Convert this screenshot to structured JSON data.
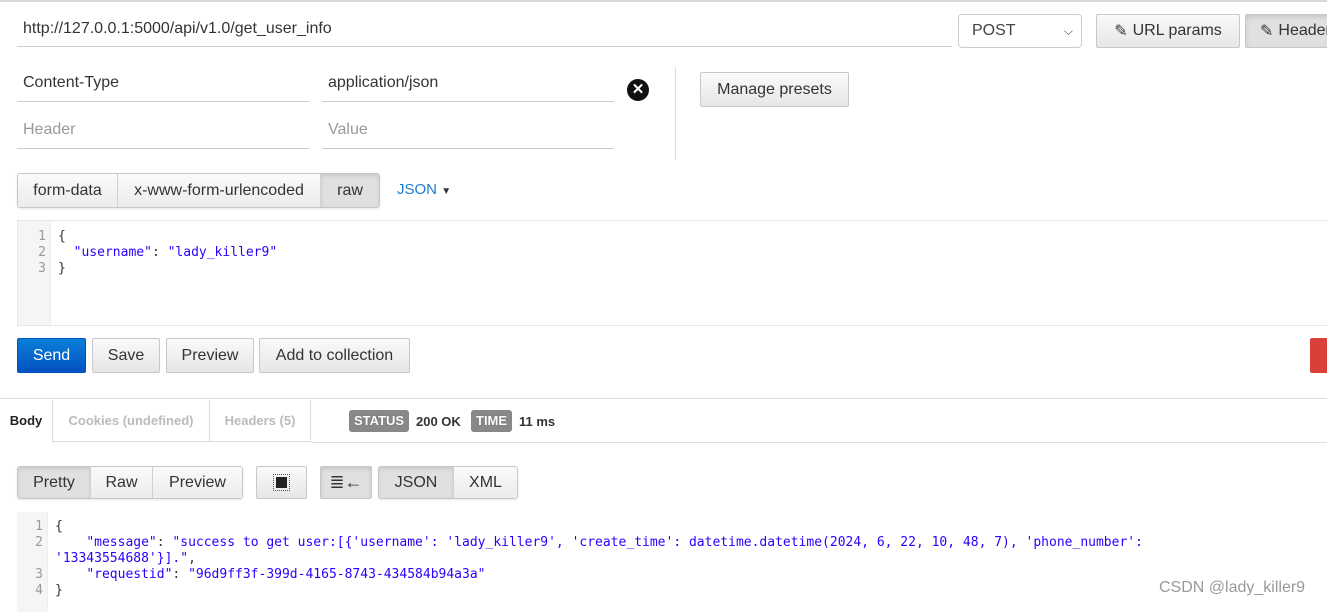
{
  "request": {
    "url": "http://127.0.0.1:5000/api/v1.0/get_user_info",
    "method": "POST",
    "url_params_label": "URL params",
    "headers_label": "Headers",
    "headers": [
      {
        "key": "Content-Type",
        "value": "application/json"
      }
    ],
    "header_placeholder": "Header",
    "value_placeholder": "Value",
    "manage_presets": "Manage presets",
    "body_modes": [
      "form-data",
      "x-www-form-urlencoded",
      "raw"
    ],
    "active_body_mode": "raw",
    "raw_type": "JSON",
    "body_lines": [
      "1",
      "2",
      "3"
    ],
    "actions": {
      "send": "Send",
      "save": "Save",
      "preview": "Preview",
      "add": "Add to collection"
    }
  },
  "response": {
    "tabs": [
      "Body",
      "Cookies (undefined)",
      "Headers (5)"
    ],
    "status_label": "STATUS",
    "status": "200 OK",
    "time_label": "TIME",
    "time": "11 ms",
    "view_modes": [
      "Pretty",
      "Raw",
      "Preview"
    ],
    "formats": [
      "JSON",
      "XML"
    ],
    "line_numbers": [
      "1",
      "2",
      "3",
      "4"
    ],
    "message_key": "\"message\"",
    "message_value": "\"success to get user:[{'username': 'lady_killer9', 'create_time': datetime.datetime(2024, 6, 22, 10, 48, 7), 'phone_number':",
    "message_value_cont": "'13343554688'}].\"",
    "requestid_key": "\"requestid\"",
    "requestid_value": "\"96d9ff3f-399d-4165-8743-434584b94a3a\""
  },
  "watermark": "CSDN @lady_killer9",
  "colors": {
    "send": "#0b6bcb",
    "link": "#1a7bd0",
    "code_string": "#2a00ff",
    "badge": "#888888"
  }
}
